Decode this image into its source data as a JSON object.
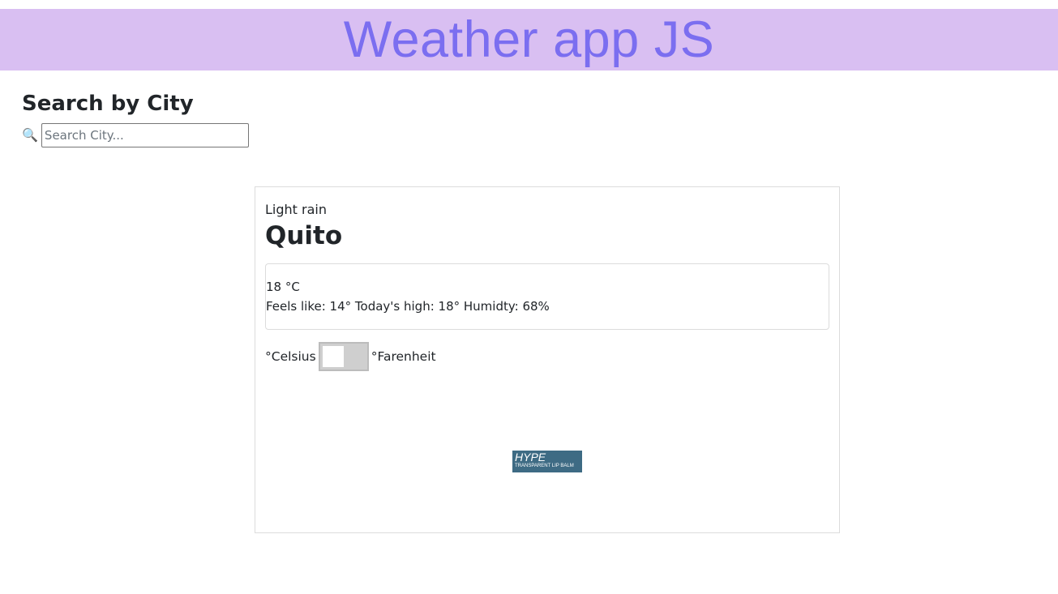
{
  "header": {
    "title": "Weather app JS",
    "background": "#d9bff2",
    "title_color": "#7b6ef0"
  },
  "search": {
    "heading": "Search by City",
    "icon": "magnifying-glass",
    "icon_glyph": "🔍",
    "placeholder": "Search City...",
    "value": ""
  },
  "weather": {
    "condition": "Light rain",
    "city": "Quito",
    "temperature": "18 °C",
    "details": "Feels like: 14° Today's high: 18° Humidty: 68%"
  },
  "units": {
    "celsius_label": "°Celsius",
    "fahrenheit_label": "°Farenheit",
    "selected": "celsius"
  },
  "ad": {
    "brand": "HYPE",
    "tagline": "TRANSPARENT LIP BALM",
    "background": "#3e6b84"
  }
}
